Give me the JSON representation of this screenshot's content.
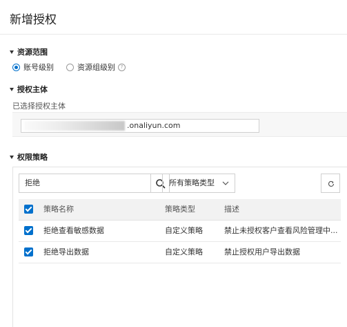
{
  "page": {
    "title": "新增授权"
  },
  "scope_section": {
    "heading": "资源范围",
    "options": [
      {
        "label": "账号级别",
        "selected": true
      },
      {
        "label": "资源组级别",
        "selected": false
      }
    ],
    "help_icon": "question-circle-icon"
  },
  "principal_section": {
    "heading": "授权主体",
    "selected_label": "已选择授权主体",
    "value": ".onaliyun.com"
  },
  "policy_section": {
    "heading": "权限策略",
    "search": {
      "value": "拒绝",
      "icon": "search-icon"
    },
    "type_filter": {
      "value": "所有策略类型",
      "icon": "chevron-down-icon"
    },
    "refresh_icon": "refresh-icon",
    "table": {
      "columns": [
        "策略名称",
        "策略类型",
        "描述"
      ],
      "rows": [
        {
          "checked": true,
          "name": "拒绝查看敏感数据",
          "type": "自定义策略",
          "desc": "禁止未授权客户查看风险管理中..."
        },
        {
          "checked": true,
          "name": "拒绝导出数据",
          "type": "自定义策略",
          "desc": "禁止授权用户导出数据"
        }
      ]
    }
  },
  "colors": {
    "accent": "#0070cc"
  }
}
